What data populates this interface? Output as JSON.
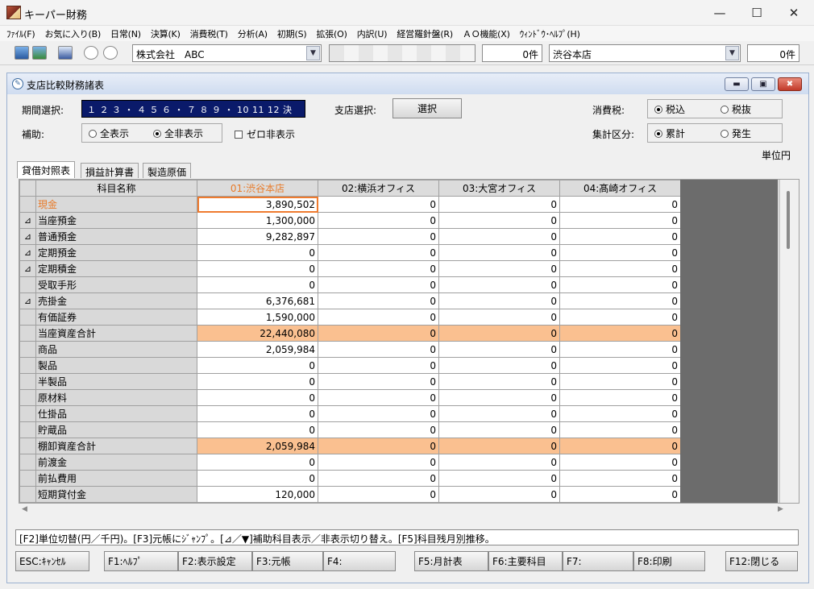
{
  "window": {
    "title": "キーパー財務"
  },
  "menu": [
    "ﾌｧｲﾙ(F)",
    "お気に入り(B)",
    "日常(N)",
    "決算(K)",
    "消費税(T)",
    "分析(A)",
    "初期(S)",
    "拡張(O)",
    "内訳(U)",
    "経営羅針盤(R)",
    "ＡＯ機能(X)",
    "ｳｨﾝﾄﾞｳ･ﾍﾙﾌﾟ(H)"
  ],
  "toolbar": {
    "company": "株式会社　ABC",
    "count1": "0件",
    "branch": "渋谷本店",
    "count2": "0件"
  },
  "child": {
    "title": "支店比較財務諸表"
  },
  "form": {
    "period_label": "期間選択:",
    "period_value": "１ ２ ３ ・ ４ ５ ６ ・ ７ ８ ９ ・ 10 11 12 決",
    "branch_label": "支店選択:",
    "select_button": "選択",
    "tax_label": "消費税:",
    "tax_in": "税込",
    "tax_out": "税抜",
    "aux_label": "補助:",
    "show_all": "全表示",
    "hide_all": "全非表示",
    "zero_hide": "ゼロ非表示",
    "agg_label": "集計区分:",
    "agg_cum": "累計",
    "agg_occ": "発生",
    "unit": "単位円"
  },
  "tabs": [
    "貸借対照表",
    "損益計算書",
    "製造原価"
  ],
  "table": {
    "headers": [
      "科目名称",
      "01:渋谷本店",
      "02:横浜オフィス",
      "03:大宮オフィス",
      "04:髙崎オフィス"
    ],
    "rows": [
      {
        "mark": "",
        "name": "現金",
        "values": [
          "3,890,502",
          "0",
          "0",
          "0"
        ]
      },
      {
        "mark": "⊿",
        "name": "当座預金",
        "values": [
          "1,300,000",
          "0",
          "0",
          "0"
        ]
      },
      {
        "mark": "⊿",
        "name": "普通預金",
        "values": [
          "9,282,897",
          "0",
          "0",
          "0"
        ]
      },
      {
        "mark": "⊿",
        "name": "定期預金",
        "values": [
          "0",
          "0",
          "0",
          "0"
        ]
      },
      {
        "mark": "⊿",
        "name": "定期積金",
        "values": [
          "0",
          "0",
          "0",
          "0"
        ]
      },
      {
        "mark": "",
        "name": "受取手形",
        "values": [
          "0",
          "0",
          "0",
          "0"
        ]
      },
      {
        "mark": "⊿",
        "name": "売掛金",
        "values": [
          "6,376,681",
          "0",
          "0",
          "0"
        ]
      },
      {
        "mark": "",
        "name": "有価証券",
        "values": [
          "1,590,000",
          "0",
          "0",
          "0"
        ]
      },
      {
        "mark": "",
        "name": "当座資産合計",
        "values": [
          "22,440,080",
          "0",
          "0",
          "0"
        ],
        "total": true
      },
      {
        "mark": "",
        "name": "商品",
        "values": [
          "2,059,984",
          "0",
          "0",
          "0"
        ]
      },
      {
        "mark": "",
        "name": "製品",
        "values": [
          "0",
          "0",
          "0",
          "0"
        ]
      },
      {
        "mark": "",
        "name": "半製品",
        "values": [
          "0",
          "0",
          "0",
          "0"
        ]
      },
      {
        "mark": "",
        "name": "原材料",
        "values": [
          "0",
          "0",
          "0",
          "0"
        ]
      },
      {
        "mark": "",
        "name": "仕掛品",
        "values": [
          "0",
          "0",
          "0",
          "0"
        ]
      },
      {
        "mark": "",
        "name": "貯蔵品",
        "values": [
          "0",
          "0",
          "0",
          "0"
        ]
      },
      {
        "mark": "",
        "name": "棚卸資産合計",
        "values": [
          "2,059,984",
          "0",
          "0",
          "0"
        ],
        "total": true
      },
      {
        "mark": "",
        "name": "前渡金",
        "values": [
          "0",
          "0",
          "0",
          "0"
        ]
      },
      {
        "mark": "",
        "name": "前払費用",
        "values": [
          "0",
          "0",
          "0",
          "0"
        ]
      },
      {
        "mark": "",
        "name": "短期貸付金",
        "values": [
          "120,000",
          "0",
          "0",
          "0"
        ]
      }
    ]
  },
  "hint": "[F2]単位切替(円／千円)。[F3]元帳にｼﾞｬﾝﾌﾟ。[⊿／▼]補助科目表示／非表示切り替え。[F5]科目残月別推移。",
  "fkeys": [
    "ESC:ｷｬﾝｾﾙ",
    "F1:ﾍﾙﾌﾟ",
    "F2:表示設定",
    "F3:元帳",
    "F4:",
    "F5:月計表",
    "F6:主要科目",
    "F7:",
    "F8:印刷",
    "F12:閉じる"
  ],
  "colors": {
    "accent": "#e87b2a",
    "total_row": "#fac090",
    "period_bg": "#0a1a6a"
  }
}
